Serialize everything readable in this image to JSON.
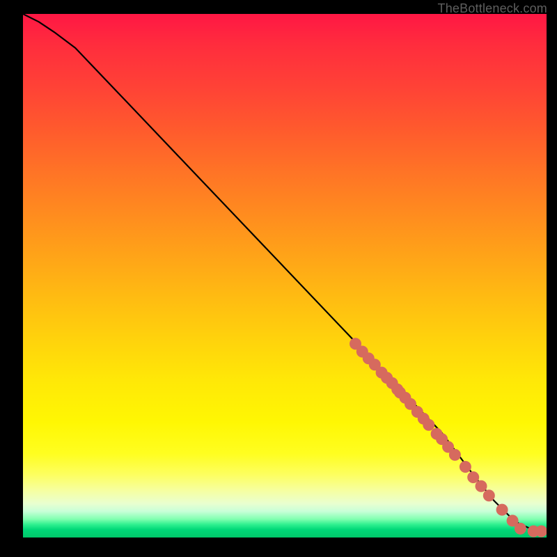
{
  "credit": "TheBottleneck.com",
  "colors": {
    "dot": "#d66a5e",
    "curve": "#000000"
  },
  "chart_data": {
    "type": "line",
    "title": "",
    "xlabel": "",
    "ylabel": "",
    "xlim": [
      0,
      100
    ],
    "ylim": [
      0,
      100
    ],
    "curve": {
      "x": [
        0,
        3,
        6,
        10,
        20,
        30,
        40,
        50,
        60,
        70,
        80,
        86,
        90,
        94,
        98,
        100
      ],
      "y": [
        100,
        98.5,
        96.5,
        93.5,
        83,
        72.5,
        62,
        51.5,
        41,
        30.5,
        20,
        12,
        7,
        3,
        1.2,
        1.2
      ]
    },
    "points": {
      "x_pct": [
        63.5,
        64.8,
        66.0,
        67.2,
        68.5,
        69.5,
        70.5,
        71.5,
        72.0,
        73.0,
        74.0,
        75.3,
        76.5,
        77.5,
        79.0,
        80.0,
        81.2,
        82.5,
        84.5,
        86.0,
        87.5,
        89.0,
        91.5,
        93.5,
        95.0,
        97.5,
        99.0
      ],
      "y_pct": [
        37.0,
        35.5,
        34.2,
        33.0,
        31.5,
        30.5,
        29.5,
        28.3,
        27.7,
        26.7,
        25.5,
        24.0,
        22.7,
        21.5,
        19.8,
        18.8,
        17.3,
        15.8,
        13.5,
        11.5,
        9.8,
        8.0,
        5.3,
        3.2,
        1.7,
        1.2,
        1.2
      ]
    }
  }
}
